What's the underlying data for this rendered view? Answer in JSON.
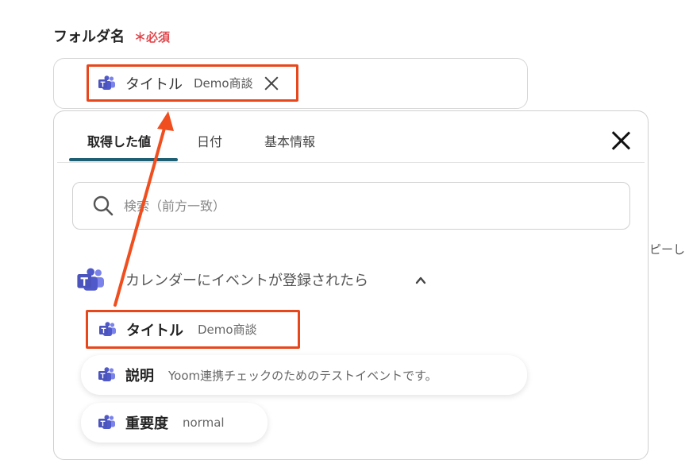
{
  "field": {
    "label": "フォルダ名",
    "required_mark": "＊必須"
  },
  "selected_chip": {
    "icon": "teams-icon",
    "label": "タイトル",
    "value": "Demo商談"
  },
  "panel": {
    "tabs": [
      {
        "label": "取得した値",
        "active": true
      },
      {
        "label": "日付",
        "active": false
      },
      {
        "label": "基本情報",
        "active": false
      }
    ],
    "search_placeholder": "検索（前方一致）",
    "section": {
      "icon": "teams-icon",
      "title": "カレンダーにイベントが登録されたら",
      "expanded": true
    },
    "items": [
      {
        "label": "タイトル",
        "value": "Demo商談",
        "highlighted": true
      },
      {
        "label": "説明",
        "value": "Yoom連携チェックのためのテストイベントです。",
        "highlighted": false
      },
      {
        "label": "重要度",
        "value": "normal",
        "highlighted": false
      }
    ]
  },
  "side_text": "ピーし",
  "colors": {
    "highlight_border": "#e8471c",
    "arrow": "#f04e1e",
    "required": "#e0474c",
    "tab_underline": "#1e5f74",
    "teams_purple": "#5059c9"
  }
}
